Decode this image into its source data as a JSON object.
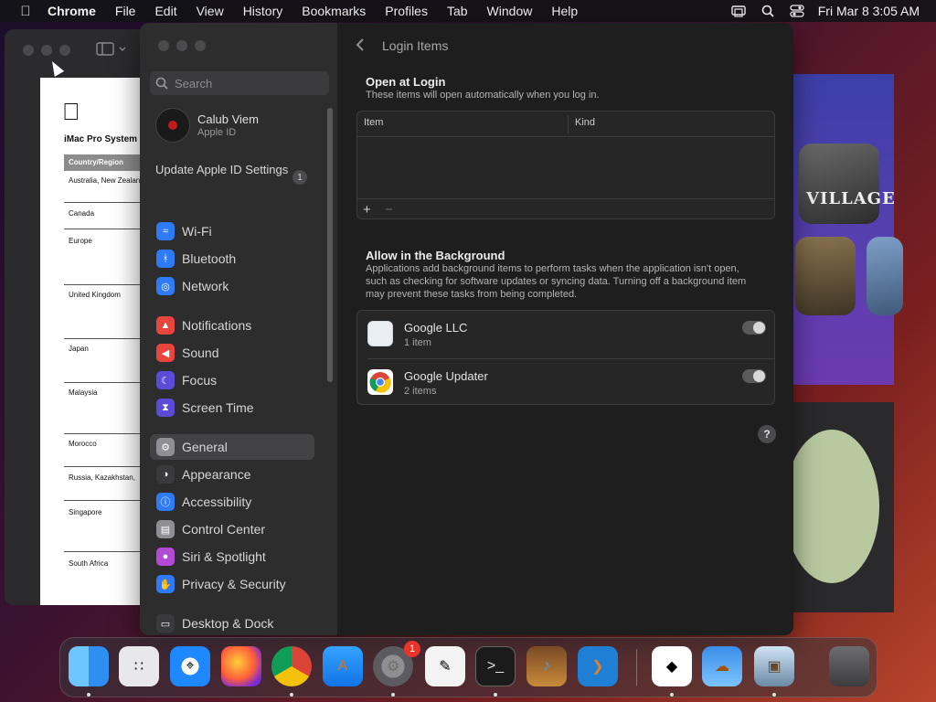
{
  "menubar": {
    "items": [
      "Chrome",
      "File",
      "Edit",
      "View",
      "History",
      "Bookmarks",
      "Profiles",
      "Tab",
      "Window",
      "Help"
    ],
    "datetime": "Fri Mar 8  3:05 AM"
  },
  "background_doc": {
    "title": "iMac Pro System",
    "header": "Country/Region",
    "rows": [
      "Australia, New Zealand",
      "Canada",
      "Europe",
      "United Kingdom",
      "Japan",
      "Malaysia",
      "Morocco",
      "Russia, Kazakhstan,",
      "Singapore",
      "South Africa"
    ]
  },
  "sidebar": {
    "search_placeholder": "Search",
    "profile_name": "Calub Viem",
    "profile_sub": "Apple ID",
    "update_label": "Update Apple ID Settings",
    "update_badge": "1",
    "items": [
      {
        "label": "Wi-Fi",
        "icon": "wifi-icon",
        "color": "#2f7bf5"
      },
      {
        "label": "Bluetooth",
        "icon": "bluetooth-icon",
        "color": "#2f7bf5"
      },
      {
        "label": "Network",
        "icon": "globe-icon",
        "color": "#2f7bf5"
      },
      {
        "label": "Notifications",
        "icon": "bell-icon",
        "color": "#e8453c"
      },
      {
        "label": "Sound",
        "icon": "speaker-icon",
        "color": "#e8453c"
      },
      {
        "label": "Focus",
        "icon": "moon-icon",
        "color": "#5b4bd6"
      },
      {
        "label": "Screen Time",
        "icon": "hourglass-icon",
        "color": "#5b4bd6"
      },
      {
        "label": "General",
        "icon": "gear-icon",
        "color": "#8e8e93"
      },
      {
        "label": "Appearance",
        "icon": "appearance-icon",
        "color": "#3a3a3c"
      },
      {
        "label": "Accessibility",
        "icon": "accessibility-icon",
        "color": "#2f7bf5"
      },
      {
        "label": "Control Center",
        "icon": "control-center-icon",
        "color": "#8e8e93"
      },
      {
        "label": "Siri & Spotlight",
        "icon": "siri-icon",
        "color": "#b34ad6"
      },
      {
        "label": "Privacy & Security",
        "icon": "hand-icon",
        "color": "#2f7bf5"
      },
      {
        "label": "Desktop & Dock",
        "icon": "desktop-icon",
        "color": "#3a3a3c"
      }
    ],
    "selected": "General"
  },
  "content": {
    "title": "Login Items",
    "open_at_login": {
      "title": "Open at Login",
      "subtitle": "These items will open automatically when you log in.",
      "col_item": "Item",
      "col_kind": "Kind",
      "add": "+",
      "remove": "−"
    },
    "allow_background": {
      "title": "Allow in the Background",
      "subtitle": "Applications add background items to perform tasks when the application isn't open, such as checking for software updates or syncing data. Turning off a background item may prevent these tasks from being completed.",
      "items": [
        {
          "name": "Google LLC",
          "count": "1 item"
        },
        {
          "name": "Google Updater",
          "count": "2 items"
        }
      ]
    },
    "help": "?"
  },
  "dock": {
    "apps": [
      "Finder",
      "Launchpad",
      "Safari",
      "Firefox",
      "Chrome",
      "App Store",
      "System Settings",
      "TextEdit",
      "Terminal",
      "GarageBand",
      "Visual Studio Code",
      "Visual Studio",
      "Weather",
      "Preview",
      "Trash"
    ],
    "settings_badge": "1"
  }
}
